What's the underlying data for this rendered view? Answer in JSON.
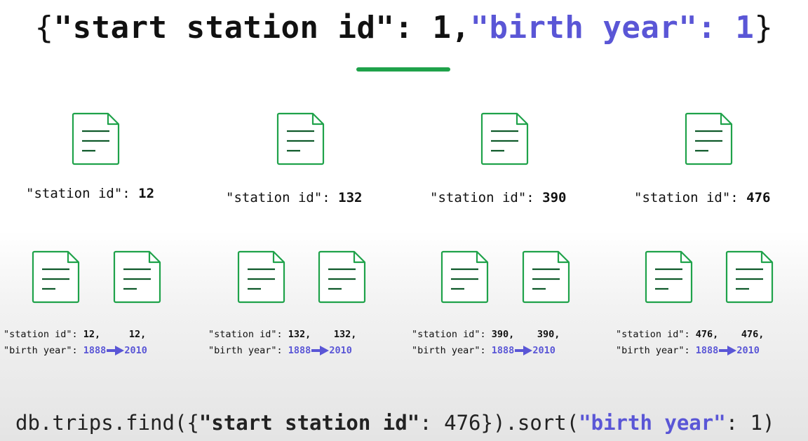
{
  "title": {
    "open_brace": "{",
    "key1": "\"start station id\"",
    "colon1": ": ",
    "val1": "1",
    "comma": ",",
    "key2": "\"birth year\"",
    "colon2": ": ",
    "val2": "1",
    "close_brace": "}"
  },
  "colors": {
    "accent_green": "#1fa24a",
    "accent_purple": "#5a56d6"
  },
  "station_key": "\"station id\": ",
  "birth_key": "\"birth year\": ",
  "level1": [
    {
      "station_id": "12"
    },
    {
      "station_id": "132"
    },
    {
      "station_id": "390"
    },
    {
      "station_id": "476"
    }
  ],
  "level2": [
    {
      "station_id": "12,",
      "second_id": "12,",
      "year_from": "1888",
      "year_to": "2010"
    },
    {
      "station_id": "132,",
      "second_id": "132,",
      "year_from": "1888",
      "year_to": "2010"
    },
    {
      "station_id": "390,",
      "second_id": "390,",
      "year_from": "1888",
      "year_to": "2010"
    },
    {
      "station_id": "476,",
      "second_id": "476,",
      "year_from": "1888",
      "year_to": "2010"
    }
  ],
  "query": {
    "prefix": "db.trips.find({",
    "key1": "\"start station id\"",
    "mid1": ": 476}).sort(",
    "key2": "\"birth year\"",
    "suffix": ": 1)"
  }
}
